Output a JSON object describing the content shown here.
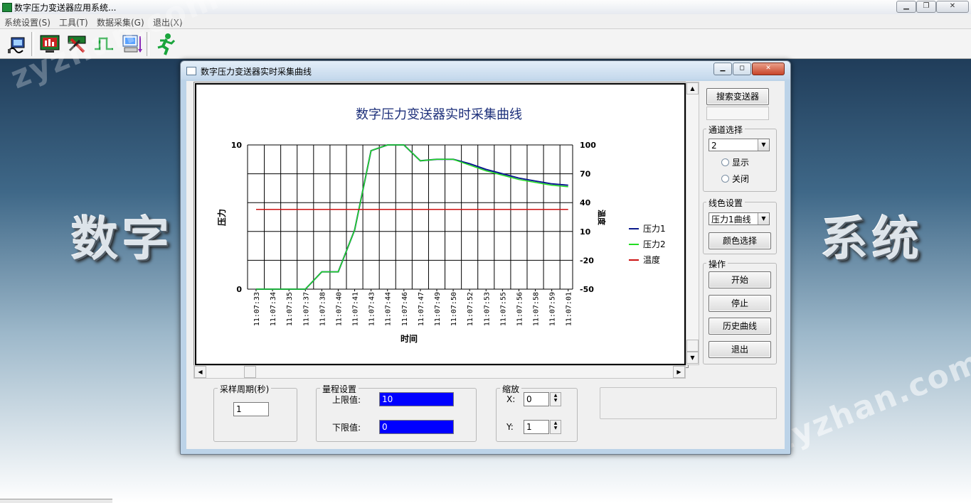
{
  "app": {
    "title": "数字压力变送器应用系统...",
    "controls": [
      "▁",
      "❐",
      "✕"
    ]
  },
  "menu": [
    "系统设置(S)",
    "工具(T)",
    "数据采集(G)",
    "退出(X)"
  ],
  "toolbar": {
    "icons": [
      "connect-icon",
      "data-monitor-icon",
      "tools-icon",
      "pulse-signal-icon",
      "computer-transfer-icon",
      "exit-runner-icon"
    ]
  },
  "background": {
    "banner_left": "数字",
    "banner_right": "系统",
    "watermark": "zyzhan.com"
  },
  "child_window": {
    "title": "数字压力变送器实时采集曲线",
    "controls": [
      "▁",
      "◻",
      "✕"
    ]
  },
  "chart_data": {
    "type": "line",
    "title": "数字压力变送器实时采集曲线",
    "xlabel": "时间",
    "ylabel": "压力",
    "y2label": "温度",
    "ylim": [
      0,
      10
    ],
    "yticks": [
      "10",
      "0"
    ],
    "y2lim": [
      -50,
      100
    ],
    "y2ticks": [
      "100",
      "70",
      "40",
      "10",
      "-20",
      "-50"
    ],
    "categories": [
      "11:07:33",
      "11:07:34",
      "11:07:35",
      "11:07:37",
      "11:07:38",
      "11:07:40",
      "11:07:41",
      "11:07:43",
      "11:07:44",
      "11:07:46",
      "11:07:47",
      "11:07:49",
      "11:07:50",
      "11:07:52",
      "11:07:53",
      "11:07:55",
      "11:07:56",
      "11:07:58",
      "11:07:59",
      "11:07:01"
    ],
    "series": [
      {
        "name": "压力1",
        "axis": "left",
        "color": "#0a1a8c",
        "values": [
          0,
          0,
          0,
          0,
          1.2,
          1.2,
          4.1,
          9.6,
          10,
          10,
          8.9,
          9.0,
          9.0,
          8.7,
          8.3,
          8.0,
          7.7,
          7.5,
          7.3,
          7.2
        ]
      },
      {
        "name": "压力2",
        "axis": "left",
        "color": "#22dd22",
        "values": [
          0,
          0,
          0,
          0,
          1.2,
          1.2,
          4.1,
          9.6,
          10,
          10,
          8.9,
          9.0,
          9.0,
          8.6,
          8.2,
          7.9,
          7.6,
          7.4,
          7.2,
          7.1
        ]
      },
      {
        "name": "温度",
        "axis": "right",
        "color": "#cc1111",
        "values": [
          33,
          33,
          33,
          33,
          33,
          33,
          33,
          33,
          33,
          33,
          33,
          33,
          33,
          33,
          33,
          33,
          33,
          33,
          33,
          33
        ]
      }
    ],
    "legend_position": "right",
    "grid": true
  },
  "right_panel": {
    "search_button": "搜索变送器",
    "channel": {
      "label": "通道选择",
      "selected": "2",
      "options": [
        "显示",
        "关闭"
      ]
    },
    "line_color": {
      "label": "线色设置",
      "selected": "压力1曲线",
      "button": "颜色选择"
    },
    "operations": {
      "label": "操作",
      "buttons": [
        "开始",
        "停止",
        "历史曲线",
        "退出"
      ]
    }
  },
  "bottom": {
    "sample": {
      "label": "采样周期(秒)",
      "value": "1"
    },
    "range": {
      "label": "量程设置",
      "upper_label": "上限值:",
      "upper_value": "10",
      "lower_label": "下限值:",
      "lower_value": "0"
    },
    "zoom": {
      "label": "缩放",
      "x_label": "X:",
      "x_value": "0",
      "y_label": "Y:",
      "y_value": "1"
    }
  }
}
